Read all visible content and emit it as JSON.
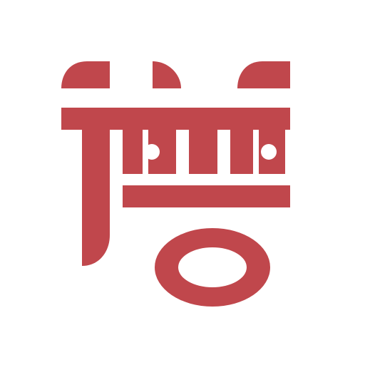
{
  "logo": {
    "name": "red-seal-logo",
    "color": "#c0474c",
    "background": "#ffffff"
  }
}
